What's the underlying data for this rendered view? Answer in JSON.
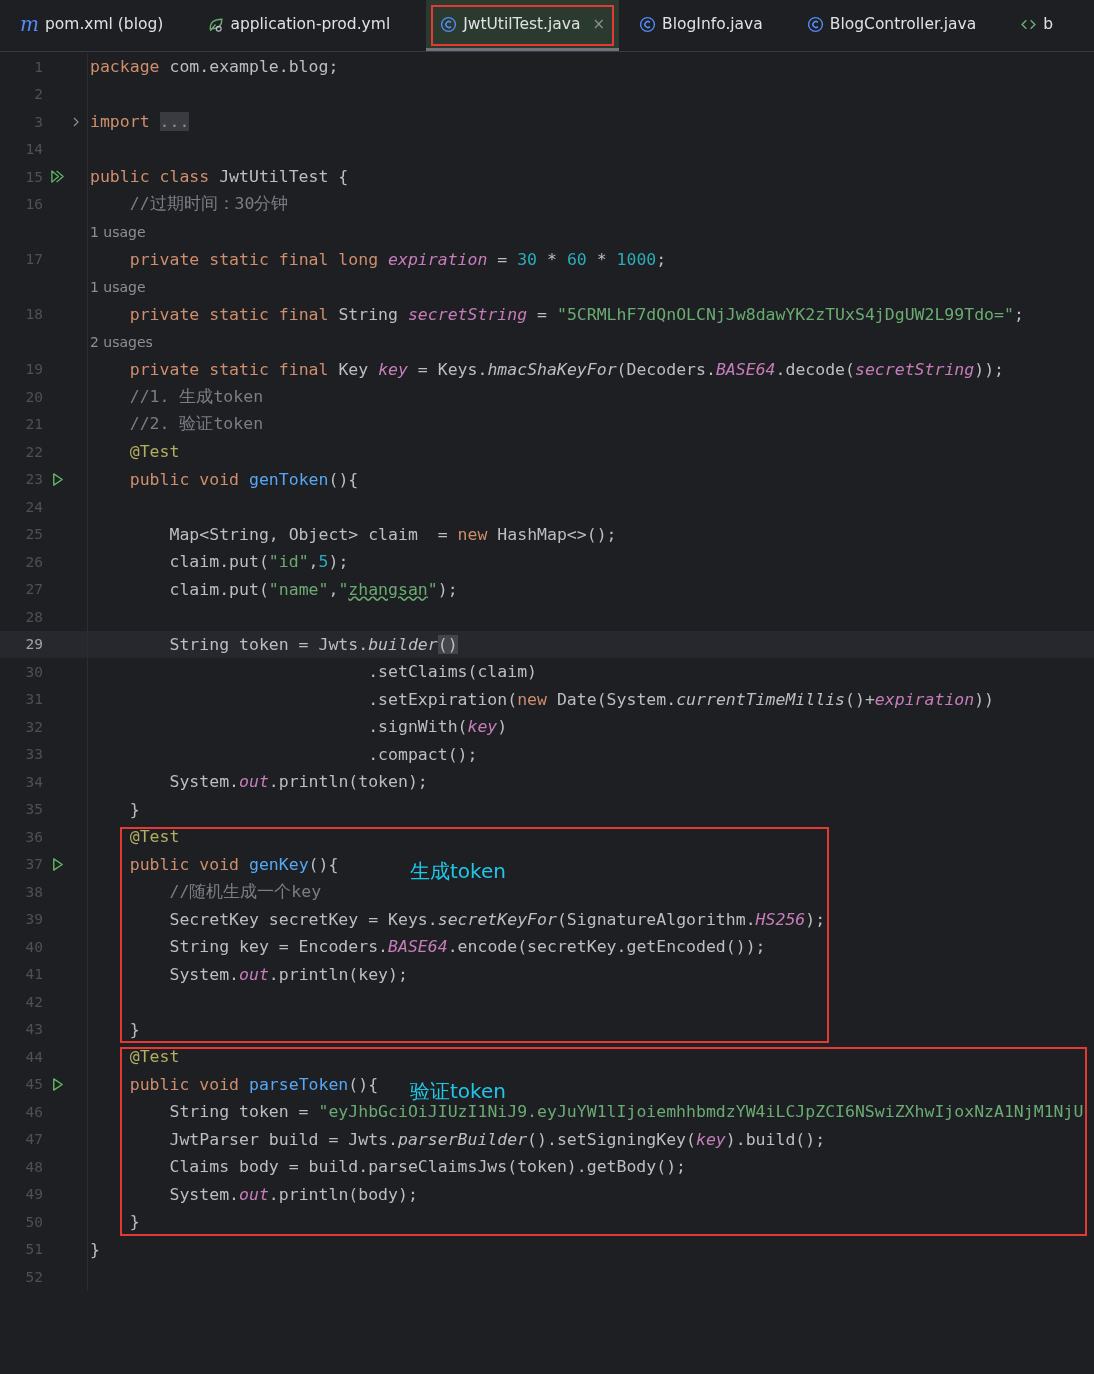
{
  "tabs": [
    {
      "label": "pom.xml (blog)",
      "kind": "maven",
      "glyph": "m",
      "selected": false,
      "highlighted": false
    },
    {
      "label": "application-prod.yml",
      "kind": "yaml",
      "selected": false,
      "highlighted": false
    },
    {
      "label": "JwtUtilTest.java",
      "kind": "class",
      "selected": true,
      "highlighted": true,
      "close": "×"
    },
    {
      "label": "BlogInfo.java",
      "kind": "class",
      "selected": false,
      "highlighted": false
    },
    {
      "label": "BlogController.java",
      "kind": "class",
      "selected": false,
      "highlighted": false
    },
    {
      "label": "b",
      "kind": "xml",
      "selected": false,
      "highlighted": false
    }
  ],
  "segments": [
    {
      "rows": [
        {
          "kind": "code",
          "number": "1",
          "current": false,
          "tokens": [
            {
              "kind": "kw",
              "text": "package "
            },
            {
              "kind": "plain",
              "text": "com.example.blog;"
            }
          ]
        },
        {
          "kind": "code",
          "number": "2",
          "current": false
        },
        {
          "kind": "code",
          "number": "3",
          "current": false,
          "marker": {
            "kind": "fold"
          },
          "tokens": [
            {
              "kind": "kw",
              "text": "import "
            },
            {
              "kind": "folded",
              "text": "..."
            }
          ]
        },
        {
          "kind": "code",
          "number": "14",
          "current": false
        },
        {
          "kind": "code",
          "number": "15",
          "current": false,
          "marker": {
            "kind": "runall"
          },
          "tokens": [
            {
              "kind": "kw",
              "text": "public class "
            },
            {
              "kind": "plain",
              "text": "JwtUtilTest {"
            }
          ]
        },
        {
          "kind": "code",
          "number": "16",
          "current": false,
          "tokens": [
            {
              "kind": "comment",
              "text": "    //过期时间：30分钟"
            }
          ]
        },
        {
          "kind": "hint",
          "text": "1 usage"
        },
        {
          "kind": "code",
          "number": "17",
          "current": false,
          "tokens": [
            {
              "kind": "kw",
              "text": "    private static final long "
            },
            {
              "kind": "field",
              "text": "expiration"
            },
            {
              "kind": "plain",
              "text": " = "
            },
            {
              "kind": "num",
              "text": "30"
            },
            {
              "kind": "plain",
              "text": " * "
            },
            {
              "kind": "num",
              "text": "60"
            },
            {
              "kind": "plain",
              "text": " * "
            },
            {
              "kind": "num",
              "text": "1000"
            },
            {
              "kind": "plain",
              "text": ";"
            }
          ]
        },
        {
          "kind": "hint",
          "text": "1 usage"
        },
        {
          "kind": "code",
          "number": "18",
          "current": false,
          "tokens": [
            {
              "kind": "kw",
              "text": "    private static final "
            },
            {
              "kind": "plain",
              "text": "String "
            },
            {
              "kind": "field",
              "text": "secretString"
            },
            {
              "kind": "plain",
              "text": " = "
            },
            {
              "kind": "str",
              "text": "\"5CRMLhF7dQnOLCNjJw8dawYK2zTUxS4jDgUW2L99Tdo=\""
            },
            {
              "kind": "plain",
              "text": ";"
            }
          ]
        },
        {
          "kind": "hint",
          "text": "2 usages"
        },
        {
          "kind": "code",
          "number": "19",
          "current": false,
          "tokens": [
            {
              "kind": "kw",
              "text": "    private static final "
            },
            {
              "kind": "plain",
              "text": "Key "
            },
            {
              "kind": "field",
              "text": "key"
            },
            {
              "kind": "plain",
              "text": " = Keys."
            },
            {
              "kind": "call",
              "text": "hmacShaKeyFor"
            },
            {
              "kind": "plain",
              "text": "(Decoders."
            },
            {
              "kind": "field",
              "text": "BASE64"
            },
            {
              "kind": "plain",
              "text": ".decode("
            },
            {
              "kind": "field",
              "text": "secretString"
            },
            {
              "kind": "plain",
              "text": "));"
            }
          ]
        },
        {
          "kind": "code",
          "number": "20",
          "current": false,
          "tokens": [
            {
              "kind": "comment",
              "text": "    //1. 生成token"
            }
          ]
        },
        {
          "kind": "code",
          "number": "21",
          "current": false,
          "tokens": [
            {
              "kind": "comment",
              "text": "    //2. 验证token"
            }
          ]
        },
        {
          "kind": "code",
          "number": "22",
          "current": false,
          "tokens": [
            {
              "kind": "annotation",
              "text": "    @Test"
            }
          ]
        },
        {
          "kind": "code",
          "number": "23",
          "current": false,
          "marker": {
            "kind": "run"
          },
          "tokens": [
            {
              "kind": "kw",
              "text": "    public void "
            },
            {
              "kind": "method",
              "text": "genToken"
            },
            {
              "kind": "plain",
              "text": "(){"
            }
          ]
        },
        {
          "kind": "code",
          "number": "24",
          "current": false
        },
        {
          "kind": "code",
          "number": "25",
          "current": false,
          "tokens": [
            {
              "kind": "plain",
              "text": "        Map<String, Object> claim  = "
            },
            {
              "kind": "kw",
              "text": "new "
            },
            {
              "kind": "plain",
              "text": "HashMap<>();"
            }
          ]
        },
        {
          "kind": "code",
          "number": "26",
          "current": false,
          "tokens": [
            {
              "kind": "plain",
              "text": "        claim.put("
            },
            {
              "kind": "str",
              "text": "\"id\""
            },
            {
              "kind": "plain",
              "text": ","
            },
            {
              "kind": "num",
              "text": "5"
            },
            {
              "kind": "plain",
              "text": ");"
            }
          ]
        },
        {
          "kind": "code",
          "number": "27",
          "current": false,
          "tokens": [
            {
              "kind": "plain",
              "text": "        claim.put("
            },
            {
              "kind": "str",
              "text": "\"name\""
            },
            {
              "kind": "plain",
              "text": ","
            },
            {
              "kind": "str",
              "text": "\""
            },
            {
              "kind": "typo",
              "text": "zhangsan"
            },
            {
              "kind": "str",
              "text": "\""
            },
            {
              "kind": "plain",
              "text": ");"
            }
          ]
        },
        {
          "kind": "code",
          "number": "28",
          "current": false
        },
        {
          "kind": "code",
          "number": "29",
          "current": true,
          "tokens": [
            {
              "kind": "plain",
              "text": "        String token = Jwts."
            },
            {
              "kind": "call",
              "text": "builder"
            },
            {
              "kind": "brace",
              "text": "()"
            }
          ]
        },
        {
          "kind": "code",
          "number": "30",
          "current": false,
          "tokens": [
            {
              "kind": "plain",
              "text": "                            .setClaims(claim)"
            }
          ]
        },
        {
          "kind": "code",
          "number": "31",
          "current": false,
          "tokens": [
            {
              "kind": "plain",
              "text": "                            .setExpiration("
            },
            {
              "kind": "kw",
              "text": "new "
            },
            {
              "kind": "plain",
              "text": "Date(System."
            },
            {
              "kind": "call",
              "text": "currentTimeMillis"
            },
            {
              "kind": "plain",
              "text": "()+"
            },
            {
              "kind": "field",
              "text": "expiration"
            },
            {
              "kind": "plain",
              "text": "))"
            }
          ]
        },
        {
          "kind": "code",
          "number": "32",
          "current": false,
          "tokens": [
            {
              "kind": "plain",
              "text": "                            .signWith("
            },
            {
              "kind": "field",
              "text": "key"
            },
            {
              "kind": "plain",
              "text": ")"
            }
          ]
        },
        {
          "kind": "code",
          "number": "33",
          "current": false,
          "tokens": [
            {
              "kind": "plain",
              "text": "                            .compact();"
            }
          ]
        },
        {
          "kind": "code",
          "number": "34",
          "current": false,
          "tokens": [
            {
              "kind": "plain",
              "text": "        System."
            },
            {
              "kind": "field",
              "text": "out"
            },
            {
              "kind": "plain",
              "text": ".println(token);"
            }
          ]
        },
        {
          "kind": "code",
          "number": "35",
          "current": false,
          "tokens": [
            {
              "kind": "plain",
              "text": "    }"
            }
          ]
        }
      ]
    },
    {
      "callout": "生成token",
      "rows": [
        {
          "kind": "code",
          "number": "36",
          "current": false,
          "tokens": [
            {
              "kind": "annotation",
              "text": "    @Test"
            }
          ]
        },
        {
          "kind": "code",
          "number": "37",
          "current": false,
          "marker": {
            "kind": "run"
          },
          "tokens": [
            {
              "kind": "kw",
              "text": "    public void "
            },
            {
              "kind": "method",
              "text": "genKey"
            },
            {
              "kind": "plain",
              "text": "(){"
            }
          ]
        },
        {
          "kind": "code",
          "number": "38",
          "current": false,
          "tokens": [
            {
              "kind": "comment",
              "text": "        //随机生成一个key"
            }
          ]
        },
        {
          "kind": "code",
          "number": "39",
          "current": false,
          "tokens": [
            {
              "kind": "plain",
              "text": "        SecretKey secretKey = Keys."
            },
            {
              "kind": "call",
              "text": "secretKeyFor"
            },
            {
              "kind": "plain",
              "text": "(SignatureAlgorithm."
            },
            {
              "kind": "field",
              "text": "HS256"
            },
            {
              "kind": "plain",
              "text": ");"
            }
          ]
        },
        {
          "kind": "code",
          "number": "40",
          "current": false,
          "tokens": [
            {
              "kind": "plain",
              "text": "        String key = Encoders."
            },
            {
              "kind": "field",
              "text": "BASE64"
            },
            {
              "kind": "plain",
              "text": ".encode(secretKey.getEncoded());"
            }
          ]
        },
        {
          "kind": "code",
          "number": "41",
          "current": false,
          "tokens": [
            {
              "kind": "plain",
              "text": "        System."
            },
            {
              "kind": "field",
              "text": "out"
            },
            {
              "kind": "plain",
              "text": ".println(key);"
            }
          ]
        },
        {
          "kind": "code",
          "number": "42",
          "current": false
        },
        {
          "kind": "code",
          "number": "43",
          "current": false,
          "tokens": [
            {
              "kind": "plain",
              "text": "    }"
            }
          ]
        }
      ]
    },
    {
      "callout": "验证token",
      "rows": [
        {
          "kind": "code",
          "number": "44",
          "current": false,
          "tokens": [
            {
              "kind": "annotation",
              "text": "    @Test"
            }
          ]
        },
        {
          "kind": "code",
          "number": "45",
          "current": false,
          "marker": {
            "kind": "run"
          },
          "tokens": [
            {
              "kind": "kw",
              "text": "    public void "
            },
            {
              "kind": "method",
              "text": "parseToken"
            },
            {
              "kind": "plain",
              "text": "(){"
            }
          ]
        },
        {
          "kind": "code",
          "number": "46",
          "current": false,
          "tokens": [
            {
              "kind": "plain",
              "text": "        String token = "
            },
            {
              "kind": "str",
              "text": "\"eyJhbGciOiJIUzI1NiJ9.eyJuYW1lIjoiemhhbmdzYW4iLCJpZCI6NSwiZXhwIjoxNzA1NjM1NjU"
            }
          ]
        },
        {
          "kind": "code",
          "number": "47",
          "current": false,
          "tokens": [
            {
              "kind": "plain",
              "text": "        JwtParser build = Jwts."
            },
            {
              "kind": "call",
              "text": "parserBuilder"
            },
            {
              "kind": "plain",
              "text": "().setSigningKey("
            },
            {
              "kind": "field",
              "text": "key"
            },
            {
              "kind": "plain",
              "text": ").build();"
            }
          ]
        },
        {
          "kind": "code",
          "number": "48",
          "current": false,
          "tokens": [
            {
              "kind": "plain",
              "text": "        Claims body = build.parseClaimsJws(token).getBody();"
            }
          ]
        },
        {
          "kind": "code",
          "number": "49",
          "current": false,
          "tokens": [
            {
              "kind": "plain",
              "text": "        System."
            },
            {
              "kind": "field",
              "text": "out"
            },
            {
              "kind": "plain",
              "text": ".println(body);"
            }
          ]
        },
        {
          "kind": "code",
          "number": "50",
          "current": false,
          "tokens": [
            {
              "kind": "plain",
              "text": "    }"
            }
          ]
        }
      ]
    },
    {
      "rows": [
        {
          "kind": "code",
          "number": "51",
          "current": false,
          "tokens": [
            {
              "kind": "plain",
              "text": "}"
            }
          ]
        },
        {
          "kind": "code",
          "number": "52",
          "current": false
        }
      ]
    }
  ]
}
